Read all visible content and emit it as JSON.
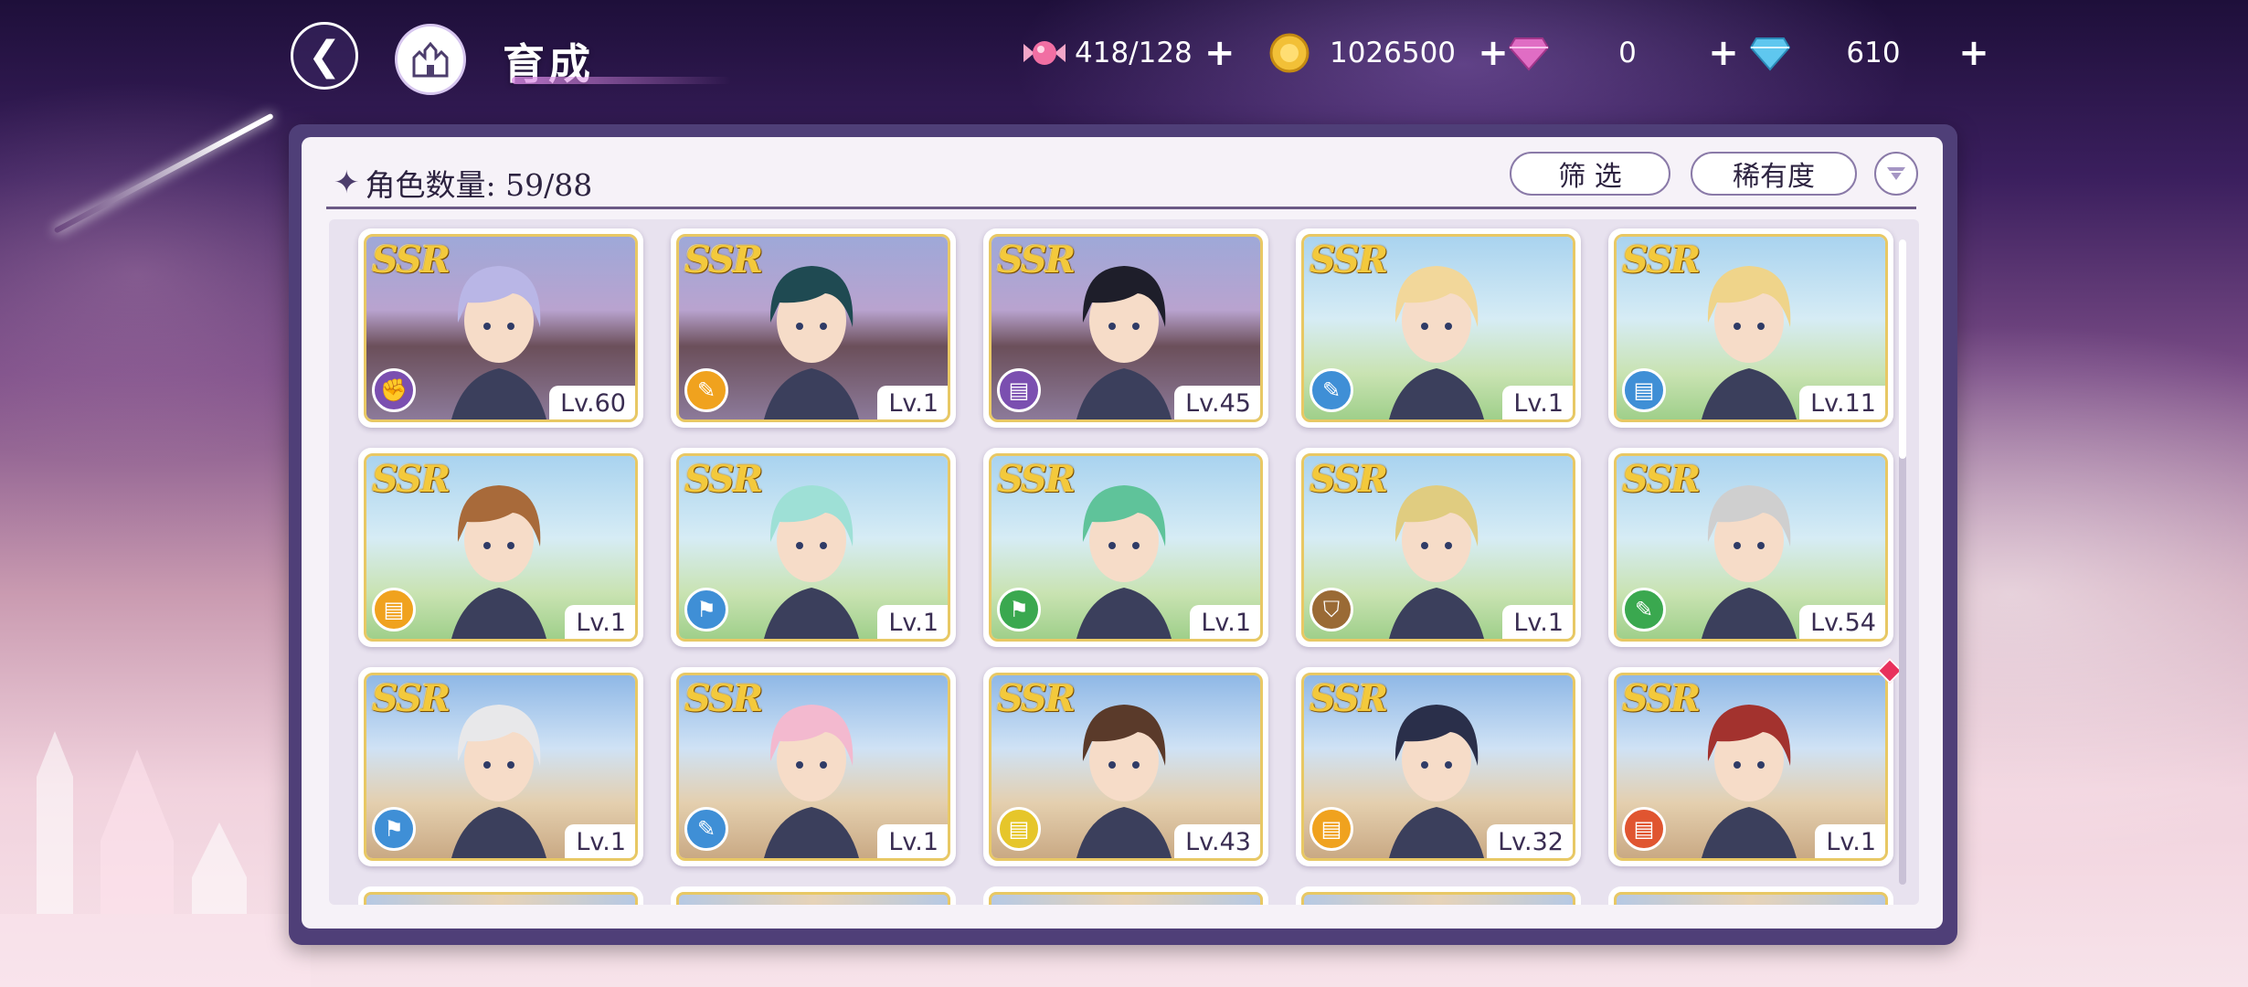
{
  "header": {
    "title": "育成",
    "currencies": [
      {
        "icon": "candy-icon",
        "value": "418/128"
      },
      {
        "icon": "gold-coin-icon",
        "value": "1026500"
      },
      {
        "icon": "pink-gem-icon",
        "value": "0"
      },
      {
        "icon": "blue-diamond-icon",
        "value": "610"
      }
    ]
  },
  "panel": {
    "count_label": "角色数量: 59/88",
    "filter_label": "筛 选",
    "rarity_label": "稀有度"
  },
  "cards": [
    {
      "rarity": "SSR",
      "level": "Lv.60",
      "role_color": "#7b4fb0",
      "role_icon": "fist-icon",
      "bg": "temple"
    },
    {
      "rarity": "SSR",
      "level": "Lv.1",
      "role_color": "#f0a21e",
      "role_icon": "wand-icon",
      "bg": "temple"
    },
    {
      "rarity": "SSR",
      "level": "Lv.45",
      "role_color": "#7b4fb0",
      "role_icon": "book-icon",
      "bg": "temple"
    },
    {
      "rarity": "SSR",
      "level": "Lv.1",
      "role_color": "#3f8fd6",
      "role_icon": "wand-icon",
      "bg": "garden"
    },
    {
      "rarity": "SSR",
      "level": "Lv.11",
      "role_color": "#3f8fd6",
      "role_icon": "book-icon",
      "bg": "garden"
    },
    {
      "rarity": "SSR",
      "level": "Lv.1",
      "role_color": "#f0a21e",
      "role_icon": "book-icon",
      "bg": "garden"
    },
    {
      "rarity": "SSR",
      "level": "Lv.1",
      "role_color": "#3f8fd6",
      "role_icon": "boot-icon",
      "bg": "garden"
    },
    {
      "rarity": "SSR",
      "level": "Lv.1",
      "role_color": "#3aa84f",
      "role_icon": "boot-icon",
      "bg": "garden"
    },
    {
      "rarity": "SSR",
      "level": "Lv.1",
      "role_color": "#9a6a35",
      "role_icon": "shield-icon",
      "bg": "garden"
    },
    {
      "rarity": "SSR",
      "level": "Lv.54",
      "role_color": "#3aa84f",
      "role_icon": "wand-icon",
      "bg": "garden"
    },
    {
      "rarity": "SSR",
      "level": "Lv.1",
      "role_color": "#3f8fd6",
      "role_icon": "boot-icon",
      "bg": "town"
    },
    {
      "rarity": "SSR",
      "level": "Lv.1",
      "role_color": "#3f8fd6",
      "role_icon": "wand-icon",
      "bg": "town"
    },
    {
      "rarity": "SSR",
      "level": "Lv.43",
      "role_color": "#e6c62a",
      "role_icon": "book-icon",
      "bg": "town"
    },
    {
      "rarity": "SSR",
      "level": "Lv.32",
      "role_color": "#f0a21e",
      "role_icon": "book-icon",
      "bg": "town"
    },
    {
      "rarity": "SSR",
      "level": "Lv.1",
      "role_color": "#e05530",
      "role_icon": "book-icon",
      "bg": "town",
      "new": true
    }
  ]
}
